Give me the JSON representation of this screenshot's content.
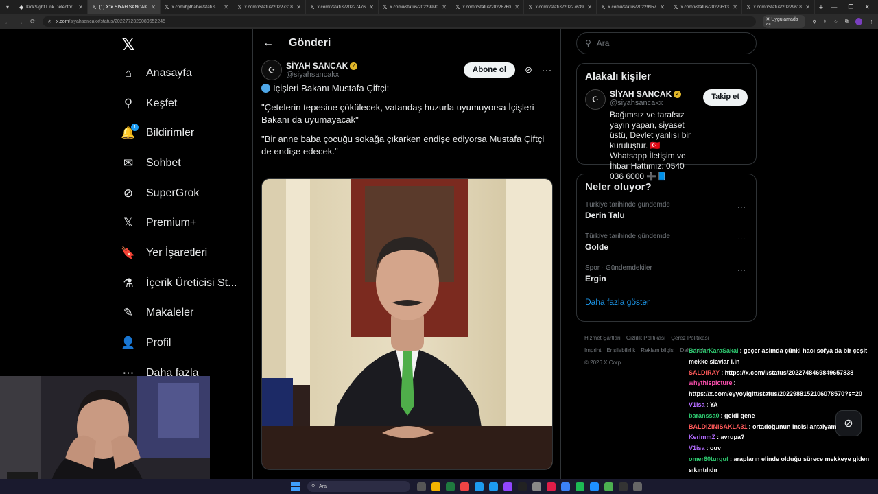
{
  "browser": {
    "tabs": [
      {
        "label": "KickSight Link Detector",
        "icon": "extension-icon",
        "active": false
      },
      {
        "label": "(1) X'te SİYAH SANCAK",
        "icon": "x-icon",
        "active": true
      },
      {
        "label": "x.com/bpthaber/status/20",
        "icon": "x-icon",
        "active": false
      },
      {
        "label": "x.com/i/status/20227318",
        "icon": "x-icon",
        "active": false
      },
      {
        "label": "x.com/i/status/20227476",
        "icon": "x-icon",
        "active": false
      },
      {
        "label": "x.com/i/status/20229990",
        "icon": "x-icon",
        "active": false
      },
      {
        "label": "x.com/i/status/20228760",
        "icon": "x-icon",
        "active": false
      },
      {
        "label": "x.com/i/status/20227639",
        "icon": "x-icon",
        "active": false
      },
      {
        "label": "x.com/i/status/20229957",
        "icon": "x-icon",
        "active": false
      },
      {
        "label": "x.com/i/status/20229513",
        "icon": "x-icon",
        "active": false
      },
      {
        "label": "x.com/i/status/20229618",
        "icon": "x-icon",
        "active": false
      }
    ],
    "url_host": "x.com",
    "url_path": "/siyahsancakx/status/2022772329080652245",
    "app_button": "Uygulamada aç"
  },
  "nav": {
    "items": [
      {
        "label": "Anasayfa",
        "icon": "home-icon",
        "glyph": "⌂"
      },
      {
        "label": "Keşfet",
        "icon": "search-icon",
        "glyph": "⚲"
      },
      {
        "label": "Bildirimler",
        "icon": "bell-icon",
        "glyph": "🔔",
        "badge": "1"
      },
      {
        "label": "Sohbet",
        "icon": "mail-icon",
        "glyph": "✉"
      },
      {
        "label": "SuperGrok",
        "icon": "grok-icon",
        "glyph": "⊘"
      },
      {
        "label": "Premium+",
        "icon": "x-icon",
        "glyph": "𝕏"
      },
      {
        "label": "Yer İşaretleri",
        "icon": "bookmark-icon",
        "glyph": "🔖"
      },
      {
        "label": "İçerik Üreticisi St...",
        "icon": "flask-icon",
        "glyph": "⚗"
      },
      {
        "label": "Makaleler",
        "icon": "article-icon",
        "glyph": "✎"
      },
      {
        "label": "Profil",
        "icon": "person-icon",
        "glyph": "👤"
      },
      {
        "label": "Daha fazla",
        "icon": "more-circle-icon",
        "glyph": "⋯"
      }
    ]
  },
  "post": {
    "header_title": "Gönderi",
    "author_name": "SİYAH SANCAK",
    "author_handle": "@siyahsancakx",
    "subscribe_label": "Abone ol",
    "text_lines": [
      "İçişleri Bakanı Mustafa Çiftçi:",
      "\"Çetelerin tepesine çökülecek, vatandaş huzurla uyumuyorsa İçişleri Bakanı da uyumayacak\"",
      "\"Bir anne baba çocuğu sokağa çıkarken endişe ediyorsa Mustafa Çiftçi de endişe edecek.\""
    ]
  },
  "right": {
    "search_placeholder": "Ara",
    "related_title": "Alakalı kişiler",
    "related_name": "SİYAH SANCAK",
    "related_handle": "@siyahsancakx",
    "follow_label": "Takip et",
    "related_bio": "Bağımsız ve tarafsız yayın yapan, siyaset üstü, Devlet yanlısı bir kuruluştur. 🇹🇷 Whatsapp İletişim ve İhbar Hattımız: 0540 036 6000 ➕📘",
    "trends_title": "Neler oluyor?",
    "trends": [
      {
        "category": "Türkiye tarihinde gündemde",
        "title": "Derin Talu"
      },
      {
        "category": "Türkiye tarihinde gündemde",
        "title": "Golde"
      },
      {
        "category": "Spor · Gündemdekiler",
        "title": "Ergin"
      }
    ],
    "show_more": "Daha fazla göster",
    "footer": [
      "Hizmet Şartları",
      "Gizlilik Politikası",
      "Çerez Politikası",
      "Imprint",
      "Erişilebilirlik",
      "Reklam bilgisi",
      "Daha fazla",
      "© 2026 X Corp."
    ]
  },
  "chat": [
    {
      "user": "BarbarKaraSakal",
      "color": "#2ecc71",
      "msg": ": geçer aslında çünki hacı sofya da bir çeşit mekke slavlar i.in",
      "wrap": true
    },
    {
      "user": "SALDIRAY",
      "color": "#ff5a5a",
      "msg": ": https://x.com/i/status/2022748469849657838"
    },
    {
      "user": "whythispicture",
      "color": "#ff4fb0",
      "msg": ":"
    },
    {
      "user": "",
      "color": "#fff",
      "msg": "https://x.com/eyyoyigitt/status/2022988152106078570?s=20"
    },
    {
      "user": "V1isa",
      "color": "#b36bff",
      "msg": ": YA"
    },
    {
      "user": "baranssa0",
      "color": "#2ecc71",
      "msg": ": geldi gene"
    },
    {
      "user": "BALDIZINISAKLA31",
      "color": "#ff5a5a",
      "msg": ": ortadoğunun incisi antalyam"
    },
    {
      "user": "KerimmZ",
      "color": "#b36bff",
      "msg": ": avrupa?"
    },
    {
      "user": "V1isa",
      "color": "#b36bff",
      "msg": ": ouv"
    },
    {
      "user": "omer60turgut",
      "color": "#2ecc71",
      "msg": ": arapların elinde olduğu sürece mekkeye giden sıkıntılıdır",
      "wrap": true
    }
  ],
  "taskbar": {
    "search_label": "Ara"
  }
}
